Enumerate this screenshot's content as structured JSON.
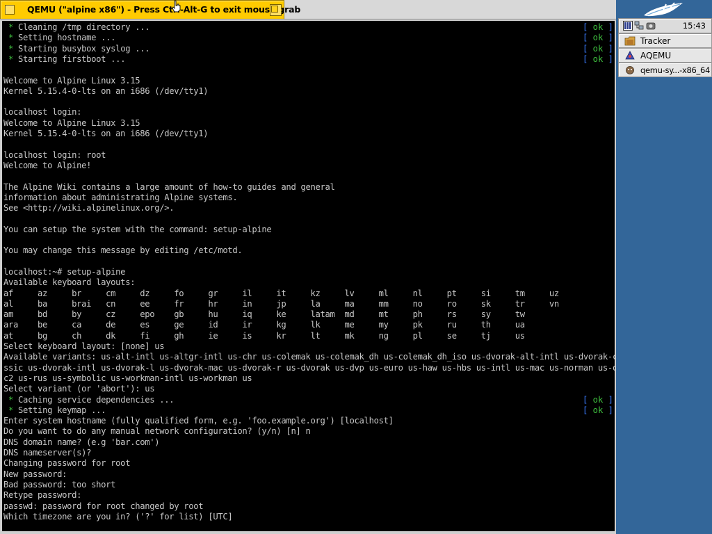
{
  "window": {
    "title": "QEMU (\"alpine x86\") - Press Ctrl-Alt-G to exit mouse grab"
  },
  "terminal": {
    "lines": [
      {
        "star": true,
        "text": "Cleaning /tmp directory ...",
        "status": "ok"
      },
      {
        "star": true,
        "text": "Setting hostname ...",
        "status": "ok"
      },
      {
        "star": true,
        "text": "Starting busybox syslog ...",
        "status": "ok"
      },
      {
        "star": true,
        "text": "Starting firstboot ...",
        "status": "ok"
      },
      {
        "text": ""
      },
      {
        "text": "Welcome to Alpine Linux 3.15"
      },
      {
        "text": "Kernel 5.15.4-0-lts on an i686 (/dev/tty1)"
      },
      {
        "text": ""
      },
      {
        "text": "localhost login:"
      },
      {
        "text": "Welcome to Alpine Linux 3.15"
      },
      {
        "text": "Kernel 5.15.4-0-lts on an i686 (/dev/tty1)"
      },
      {
        "text": ""
      },
      {
        "text": "localhost login: root"
      },
      {
        "text": "Welcome to Alpine!"
      },
      {
        "text": ""
      },
      {
        "text": "The Alpine Wiki contains a large amount of how-to guides and general"
      },
      {
        "text": "information about administrating Alpine systems."
      },
      {
        "text": "See <http://wiki.alpinelinux.org/>."
      },
      {
        "text": ""
      },
      {
        "text": "You can setup the system with the command: setup-alpine"
      },
      {
        "text": ""
      },
      {
        "text": "You may change this message by editing /etc/motd."
      },
      {
        "text": ""
      },
      {
        "text": "localhost:~# setup-alpine"
      },
      {
        "text": "Available keyboard layouts:"
      },
      {
        "text": "af     az     br     cm     dz     fo     gr     il     it     kz     lv     ml     nl     pt     si     tm     uz"
      },
      {
        "text": "al     ba     brai   cn     ee     fr     hr     in     jp     la     ma     mm     no     ro     sk     tr     vn"
      },
      {
        "text": "am     bd     by     cz     epo    gb     hu     iq     ke     latam  md     mt     ph     rs     sy     tw"
      },
      {
        "text": "ara    be     ca     de     es     ge     id     ir     kg     lk     me     my     pk     ru     th     ua"
      },
      {
        "text": "at     bg     ch     dk     fi     gh     ie     is     kr     lt     mk     ng     pl     se     tj     us"
      },
      {
        "text": "Select keyboard layout: [none] us"
      },
      {
        "text": "Available variants: us-alt-intl us-altgr-intl us-chr us-colemak us-colemak_dh us-colemak_dh_iso us-dvorak-alt-intl us-dvorak-cla"
      },
      {
        "text": "ssic us-dvorak-intl us-dvorak-l us-dvorak-mac us-dvorak-r us-dvorak us-dvp us-euro us-haw us-hbs us-intl us-mac us-norman us-olp"
      },
      {
        "text": "c2 us-rus us-symbolic us-workman-intl us-workman us"
      },
      {
        "text": "Select variant (or 'abort'): us"
      },
      {
        "star": true,
        "text": "Caching service dependencies ...",
        "status": "ok"
      },
      {
        "star": true,
        "text": "Setting keymap ...",
        "status": "ok"
      },
      {
        "text": "Enter system hostname (fully qualified form, e.g. 'foo.example.org') [localhost]"
      },
      {
        "text": "Do you want to do any manual network configuration? (y/n) [n] n"
      },
      {
        "text": "DNS domain name? (e.g 'bar.com')"
      },
      {
        "text": "DNS nameserver(s)?"
      },
      {
        "text": "Changing password for root"
      },
      {
        "text": "New password:"
      },
      {
        "text": "Bad password: too short"
      },
      {
        "text": "Retype password:"
      },
      {
        "text": "passwd: password for root changed by root"
      },
      {
        "text": "Which timezone are you in? ('?' for list) [UTC]"
      }
    ]
  },
  "deskbar": {
    "clock": "15:43",
    "items": [
      {
        "label": "Tracker",
        "icon": "tracker-icon"
      },
      {
        "label": "AQEMU",
        "icon": "aqemu-icon"
      },
      {
        "label": "qemu-sy...-x86_64",
        "icon": "qemu-icon"
      }
    ]
  },
  "colors": {
    "desktop": "#336699",
    "tab": "#ffcb00",
    "terminal_bg": "#000000",
    "terminal_fg": "#c7c7c7",
    "ok_green": "#3fbf3f",
    "bracket_blue": "#3b7bff"
  }
}
